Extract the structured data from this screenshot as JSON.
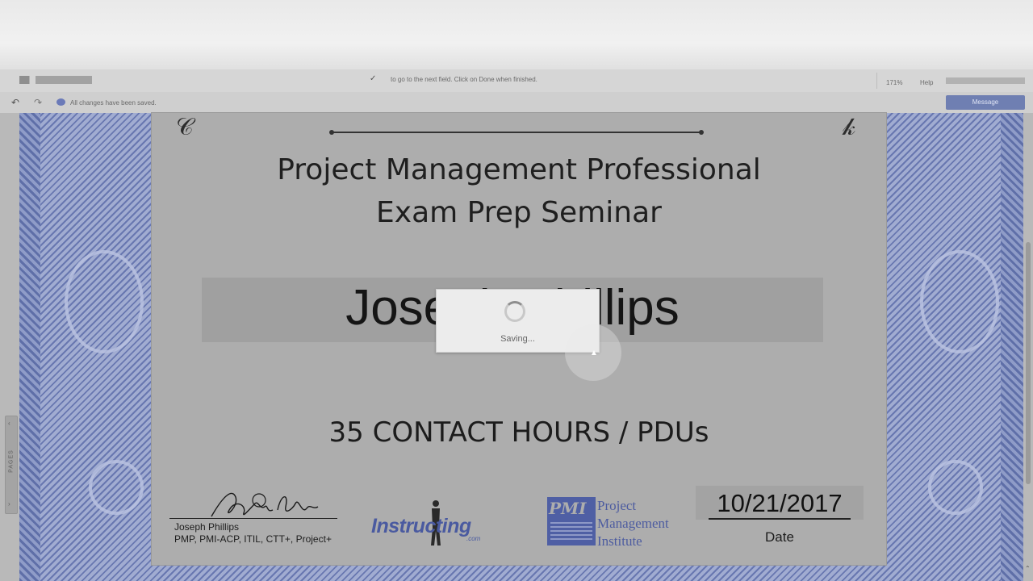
{
  "toolbar": {
    "hint": "to go to the next field. Click on Done when finished.",
    "zoom": "171%",
    "help": "Help"
  },
  "save_bar": {
    "status": "All changes have been saved.",
    "message_button": "Message"
  },
  "left_rail": {
    "pages_label": "PAGES"
  },
  "certificate": {
    "title_line1": "Project Management Professional",
    "title_line2": "Exam Prep Seminar",
    "recipient_name": "Joseph Phillips",
    "hours": "35 CONTACT HOURS / PDUs",
    "signer_name": "Joseph Phillips",
    "signer_credentials": "PMP, PMI-ACP, ITIL, CTT+, Project+",
    "instructing_logo": "Instructing",
    "instructing_logo_sub": ".com",
    "pmi_logo_letters": "PMI",
    "pmi_line1": "Project",
    "pmi_line2": "Management",
    "pmi_line3": "Institute",
    "date_value": "10/21/2017",
    "date_label": "Date"
  },
  "modal": {
    "text": "Saving..."
  },
  "colors": {
    "border_blue": "#6d7cb5",
    "panel_gray": "#adadad",
    "logo_blue": "#4a5aa0"
  }
}
